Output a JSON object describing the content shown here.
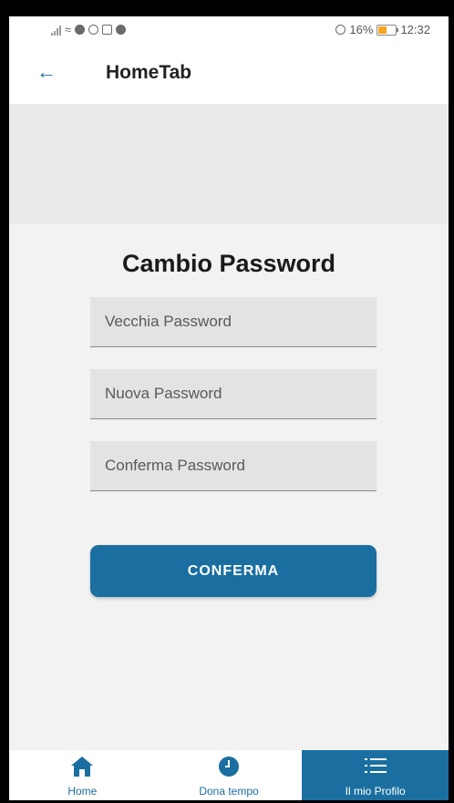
{
  "status_bar": {
    "battery": "16%",
    "time": "12:32"
  },
  "app_bar": {
    "back_icon": "arrow-left-icon",
    "title": "HomeTab"
  },
  "form": {
    "title": "Cambio Password",
    "fields": [
      {
        "placeholder": "Vecchia Password",
        "value": ""
      },
      {
        "placeholder": "Nuova Password",
        "value": ""
      },
      {
        "placeholder": "Conferma Password",
        "value": ""
      }
    ],
    "submit_label": "CONFERMA"
  },
  "bottom_nav": {
    "items": [
      {
        "label": "Home",
        "icon": "home-icon",
        "active": false
      },
      {
        "label": "Dona tempo",
        "icon": "clock-icon",
        "active": false
      },
      {
        "label": "Il mio Profilo",
        "icon": "list-icon",
        "active": true
      }
    ]
  },
  "colors": {
    "accent": "#1a6fa0",
    "background": "#f2f2f2",
    "field_bg": "#e3e3e3"
  }
}
